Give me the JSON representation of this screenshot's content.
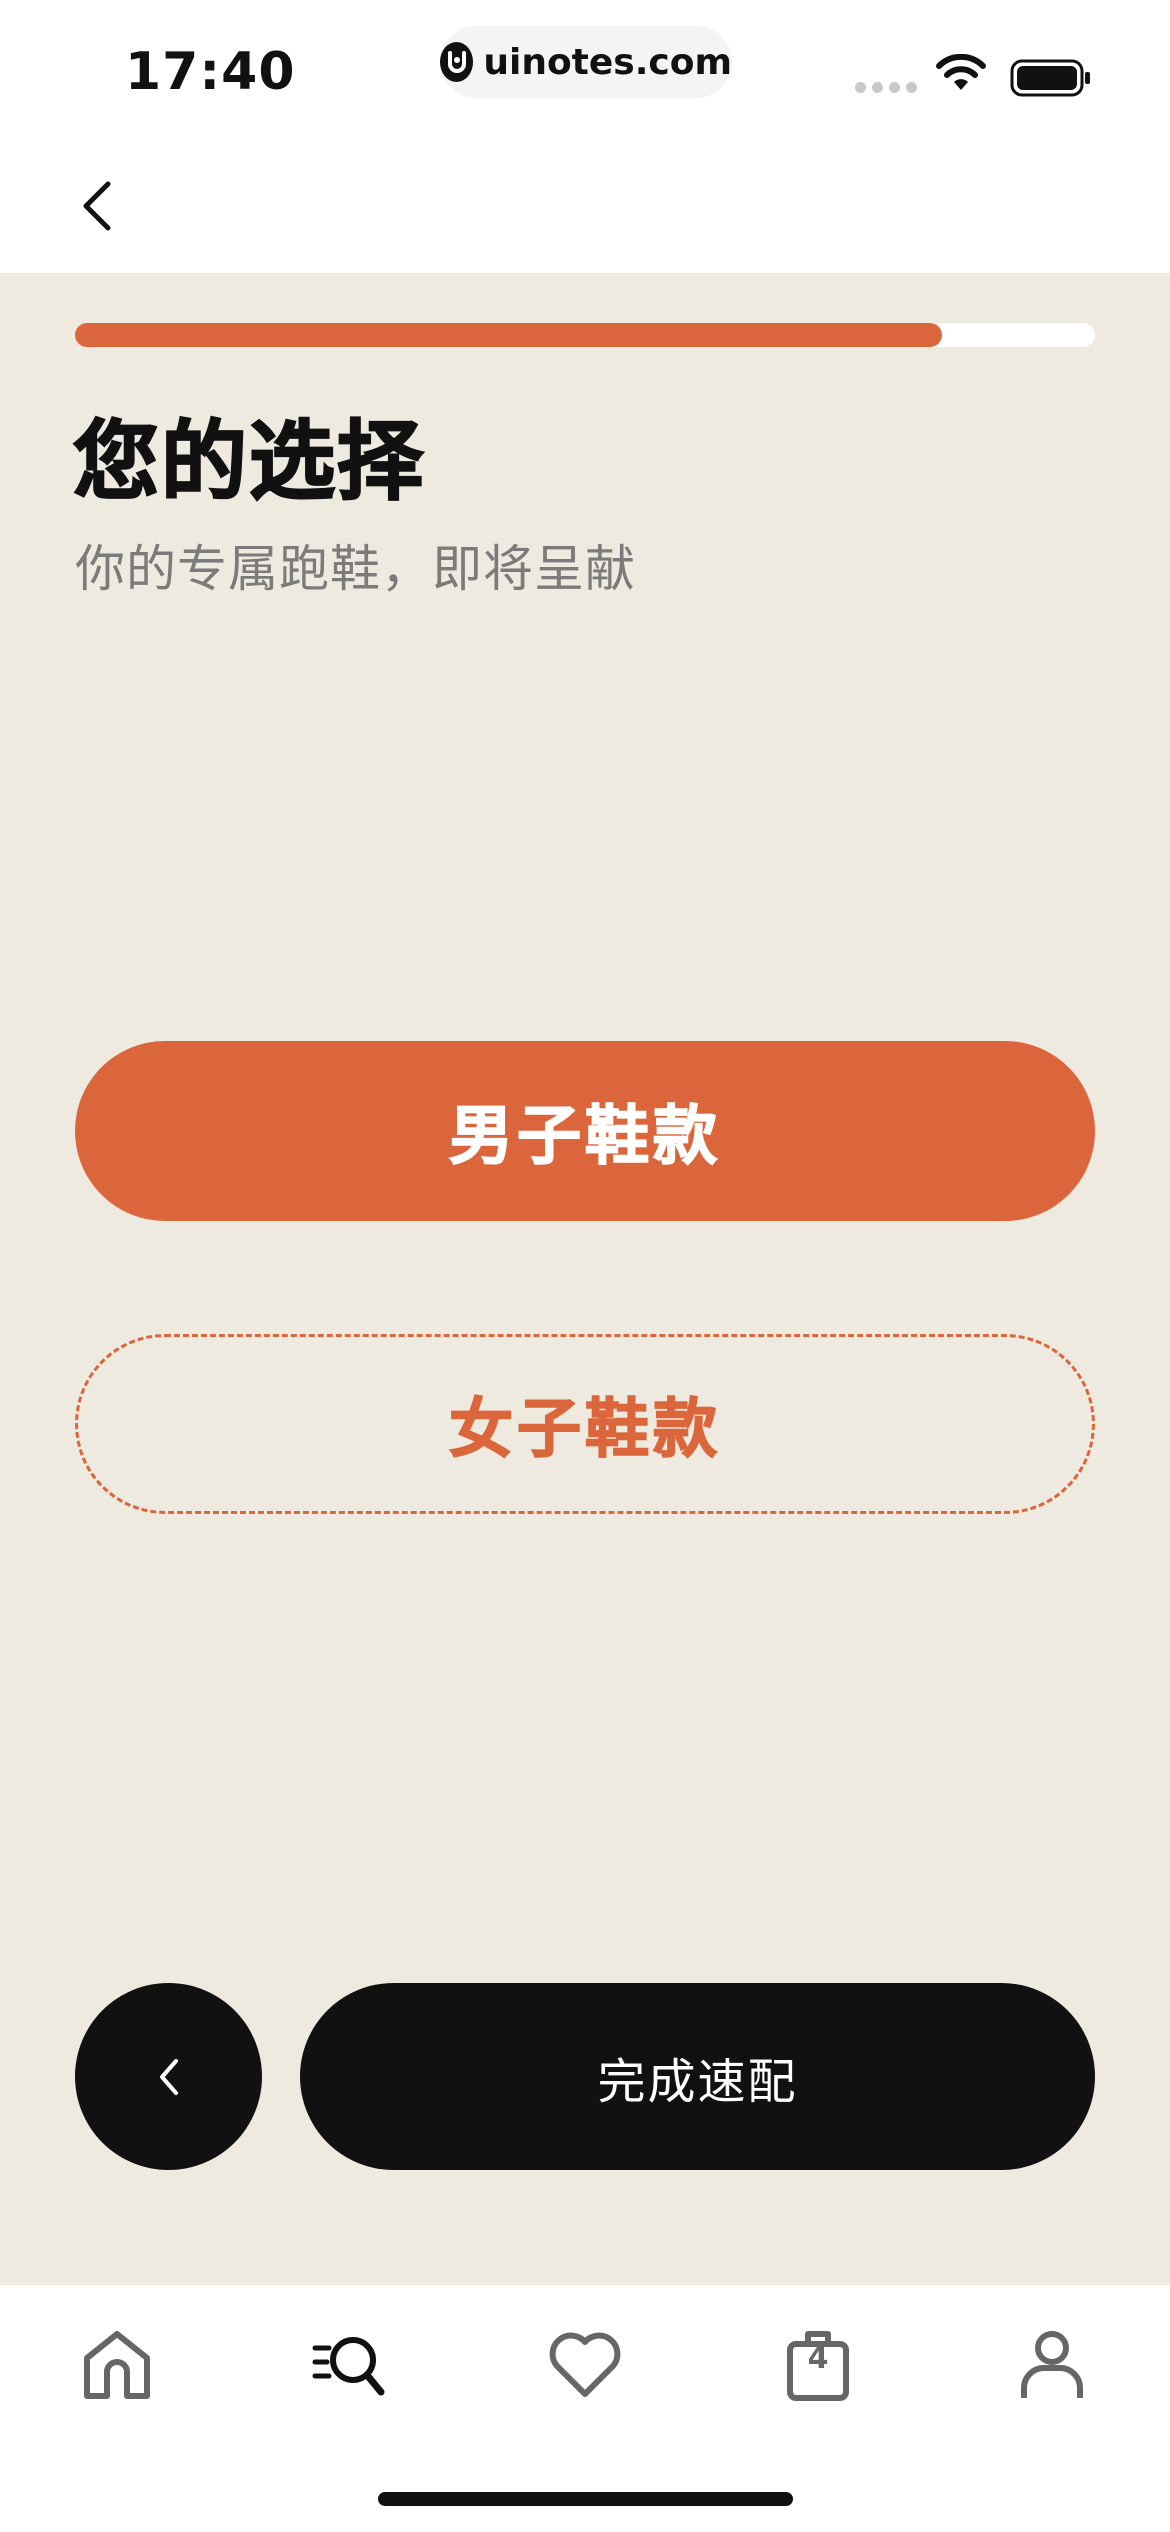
{
  "status_bar": {
    "time": "17:40",
    "url": "uinotes.com"
  },
  "progress": {
    "fraction": 0.85,
    "fill_color": "#db663b",
    "track_color": "#ffffff"
  },
  "header": {
    "title": "您的选择",
    "subtitle": "你的专属跑鞋，即将呈献"
  },
  "options": [
    {
      "label": "男子鞋款",
      "selected": true
    },
    {
      "label": "女子鞋款",
      "selected": false
    }
  ],
  "actions": {
    "finish_label": "完成速配"
  },
  "tab_bar": {
    "items": [
      {
        "icon": "home-icon"
      },
      {
        "icon": "search-icon"
      },
      {
        "icon": "heart-icon"
      },
      {
        "icon": "bag-icon",
        "badge": "4"
      },
      {
        "icon": "profile-icon"
      }
    ]
  },
  "colors": {
    "accent": "#db663b",
    "background": "#efeadf",
    "dark": "#111111",
    "muted_text": "#7b7b7b"
  }
}
